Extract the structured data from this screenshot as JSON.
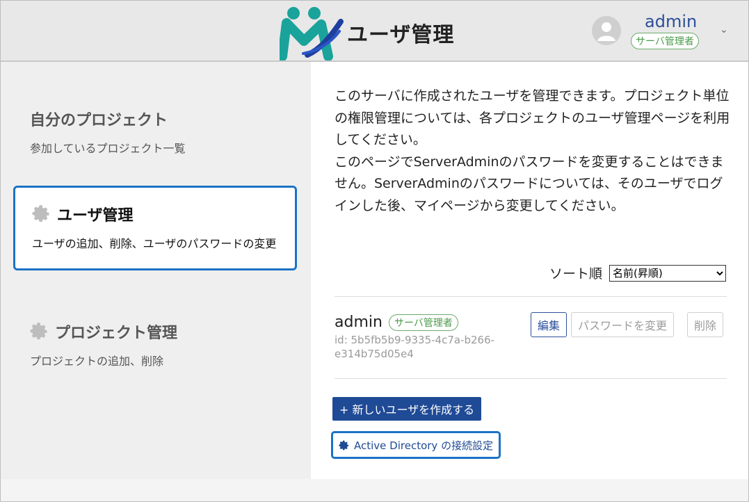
{
  "header": {
    "title": "ユーザ管理",
    "user_name": "admin",
    "user_role": "サーバ管理者",
    "menu_chevron": "⌄"
  },
  "sidebar": {
    "items": [
      {
        "title": "自分のプロジェクト",
        "desc": "参加しているプロジェクト一覧",
        "icon": ""
      },
      {
        "title": "ユーザ管理",
        "desc": "ユーザの追加、削除、ユーザのパスワードの変更",
        "icon": "gear-icon"
      },
      {
        "title": "プロジェクト管理",
        "desc": "プロジェクトの追加、削除",
        "icon": "gear-icon"
      }
    ]
  },
  "main": {
    "description_1": "このサーバに作成されたユーザを管理できます。プロジェクト単位の権限管理については、各プロジェクトのユーザ管理ページを利用してください。",
    "description_2": "このページでServerAdminのパスワードを変更することはできません。ServerAdminのパスワードについては、そのユーザでログインした後、マイページから変更してください。",
    "sort_label": "ソート順",
    "sort_selected": "名前(昇順)",
    "users": [
      {
        "name": "admin",
        "badge": "サーバ管理者",
        "id": "id: 5b5fb5b9-9335-4c7a-b266-e314b75d05e4",
        "edit_label": "編集",
        "password_label": "パスワードを変更",
        "delete_label": "削除"
      }
    ],
    "create_label": "+ 新しいユーザを作成する",
    "ad_label": "Active Directory の接続設定"
  },
  "colors": {
    "accent": "#1f4a96",
    "focus": "#1a73c6",
    "badge": "#4a9a4a"
  }
}
